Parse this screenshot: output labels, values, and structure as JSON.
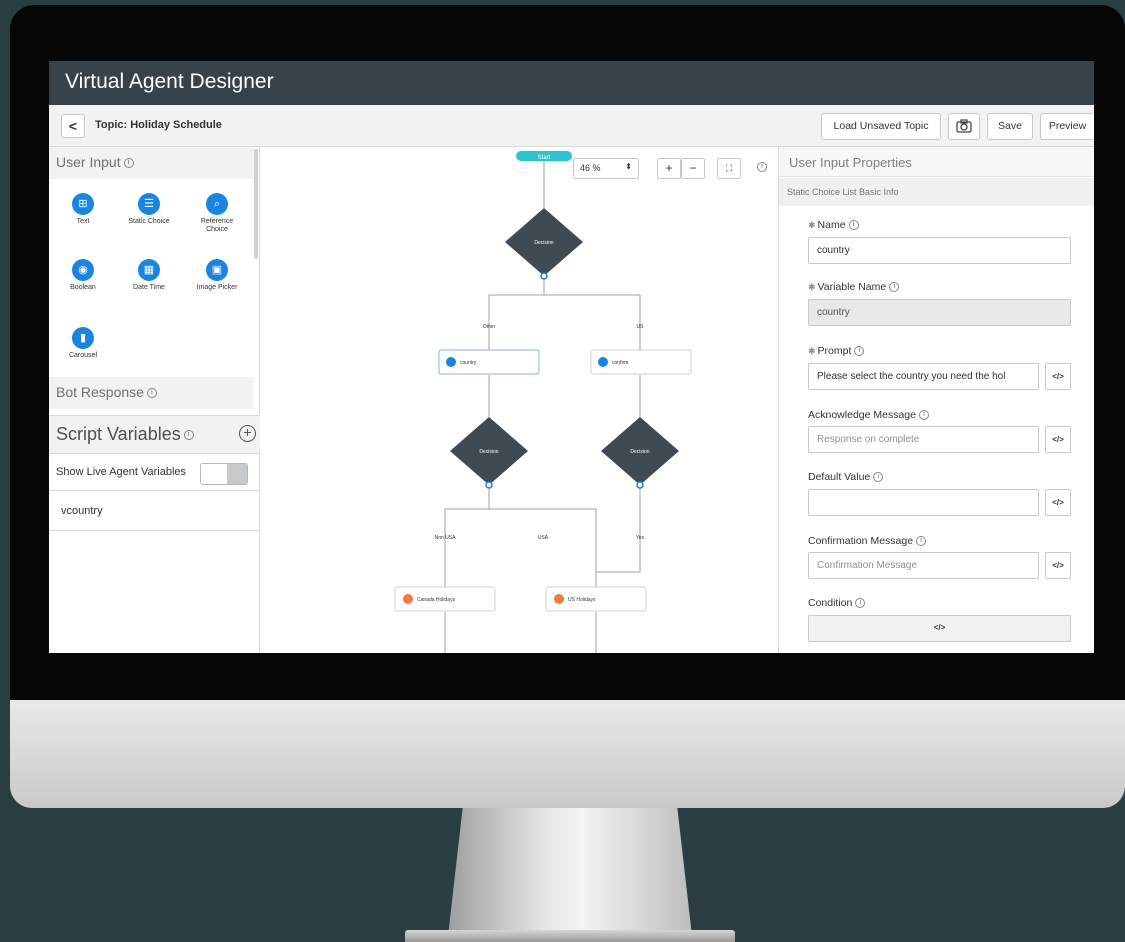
{
  "app": {
    "title": "Virtual Agent Designer"
  },
  "toolbar": {
    "back": "<",
    "topic": "Topic: Holiday Schedule",
    "load_unsaved": "Load Unsaved Topic",
    "save": "Save",
    "preview": "Preview"
  },
  "palette": {
    "user_input_title": "User Input",
    "tools": [
      {
        "label": "Text",
        "icon": "text-input-icon"
      },
      {
        "label": "Static Choice",
        "icon": "list-icon"
      },
      {
        "label": "Reference Choice",
        "icon": "search-icon"
      },
      {
        "label": "Boolean",
        "icon": "boolean-icon"
      },
      {
        "label": "Date Time",
        "icon": "calendar-icon"
      },
      {
        "label": "Image Picker",
        "icon": "image-icon"
      },
      {
        "label": "Carousel",
        "icon": "carousel-icon"
      }
    ],
    "bot_response_title": "Bot Response"
  },
  "script_vars": {
    "title": "Script Variables",
    "live_agent_label": "Show Live Agent Variables",
    "live_agent_enabled": false,
    "items": [
      "vcountry"
    ]
  },
  "canvas": {
    "zoom": "46 %",
    "zoom_in": "+",
    "zoom_out": "−",
    "start_label": "Start",
    "decision_label": "Decision",
    "nodes": {
      "country": "country",
      "confirm": "confirm",
      "canada": "Canada Holidays",
      "us": "US Holidays"
    },
    "edges": {
      "other": "Other",
      "us": "US",
      "non_usa": "Non USA",
      "usa": "USA",
      "yes": "Yes"
    },
    "colors": {
      "decision": "#3f4a53",
      "start": "#2cc3d1",
      "accent": "#1a85e0",
      "response": "#f07d3b"
    }
  },
  "properties": {
    "title": "User Input Properties",
    "section": "Static Choice List Basic Info",
    "name_label": "Name",
    "name_value": "country",
    "varname_label": "Variable Name",
    "varname_value": "country",
    "prompt_label": "Prompt",
    "prompt_value": "Please select the country you need the hol",
    "ack_label": "Acknowledge Message",
    "ack_placeholder": "Response on complete",
    "default_label": "Default Value",
    "default_value": "",
    "confirm_label": "Confirmation Message",
    "confirm_placeholder": "Confirmation Message",
    "condition_label": "Condition",
    "code_glyph": "</>"
  }
}
